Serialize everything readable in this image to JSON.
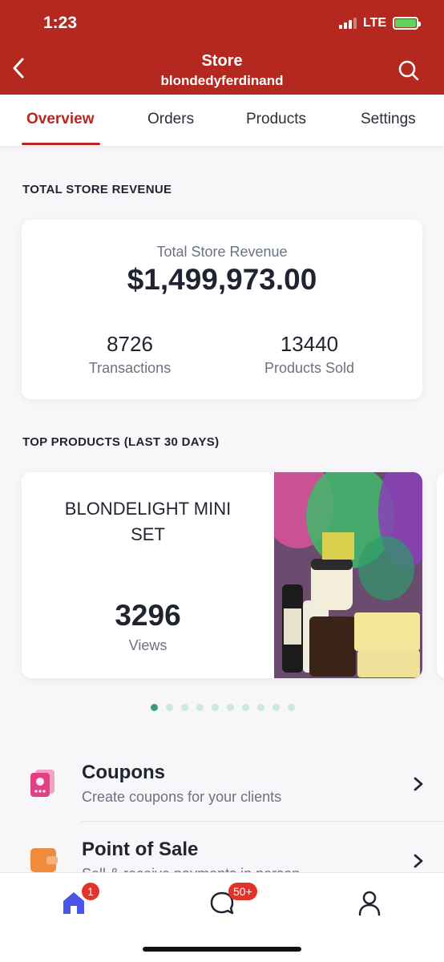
{
  "status_bar": {
    "time": "1:23",
    "network": "LTE"
  },
  "nav": {
    "title": "Store",
    "subtitle": "blondedyferdinand"
  },
  "tabs": [
    {
      "label": "Overview",
      "active": true
    },
    {
      "label": "Orders",
      "active": false
    },
    {
      "label": "Products",
      "active": false
    },
    {
      "label": "Settings",
      "active": false
    }
  ],
  "revenue": {
    "section_title": "TOTAL STORE REVENUE",
    "label": "Total Store Revenue",
    "value": "$1,499,973.00",
    "transactions": {
      "value": "8726",
      "label": "Transactions"
    },
    "products_sold": {
      "value": "13440",
      "label": "Products Sold"
    }
  },
  "top_products": {
    "section_title": "TOP PRODUCTS (LAST 30 DAYS)",
    "items": [
      {
        "name": "BLONDELIGHT MINI SET",
        "views": "3296",
        "views_label": "Views"
      }
    ],
    "pagination": {
      "count": 10,
      "active_index": 0
    }
  },
  "menu": [
    {
      "title": "Coupons",
      "subtitle": "Create coupons for your clients",
      "icon": "coupon-icon"
    },
    {
      "title": "Point of Sale",
      "subtitle": "Sell & receive payments in person",
      "icon": "wallet-icon"
    }
  ],
  "bottom_nav": {
    "home_badge": "1",
    "messages_badge": "50+"
  },
  "colors": {
    "brand": "#b5281f",
    "dot_active": "#3aa070",
    "badge": "#e2332a",
    "home_icon": "#4b55e8"
  }
}
